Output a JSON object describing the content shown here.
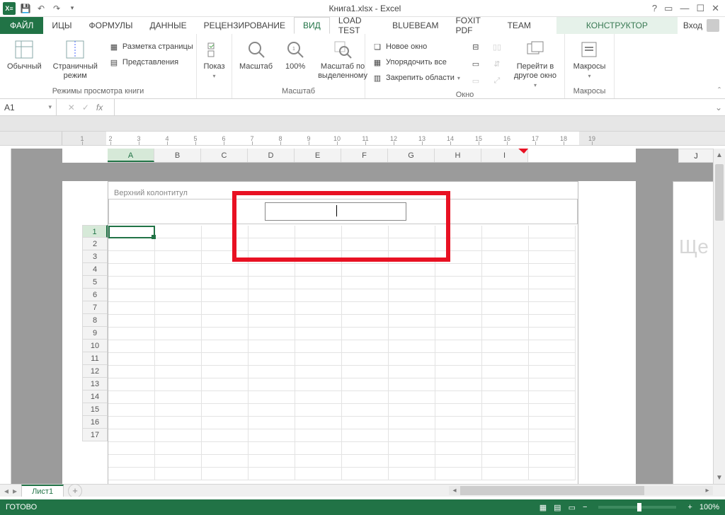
{
  "titlebar": {
    "title": "Книга1.xlsx - Excel"
  },
  "tabs": {
    "file": "ФАЙЛ",
    "items": [
      "ИЦЫ",
      "ФОРМУЛЫ",
      "ДАННЫЕ",
      "РЕЦЕНЗИРОВАНИЕ",
      "ВИД",
      "LOAD TEST",
      "BLUEBEAM",
      "Foxit PDF",
      "TEAM"
    ],
    "active": "ВИД",
    "contextual": "КОНСТРУКТОР",
    "signin": "Вход"
  },
  "ribbon": {
    "group1": {
      "normal": "Обычный",
      "page": "Страничный режим",
      "layout": "Разметка страницы",
      "views": "Представления",
      "label": "Режимы просмотра книги"
    },
    "group2": {
      "show": "Показ",
      "label": ""
    },
    "group3": {
      "zoom": "Масштаб",
      "hundred": "100%",
      "zoomsel": "Масштаб по выделенному",
      "label": "Масштаб"
    },
    "group4": {
      "newwin": "Новое окно",
      "arrange": "Упорядочить все",
      "freeze": "Закрепить области",
      "switch": "Перейти в другое окно",
      "label": "Окно"
    },
    "group5": {
      "macros": "Макросы",
      "label": "Макросы"
    }
  },
  "namebox": "A1",
  "columns": [
    "A",
    "B",
    "C",
    "D",
    "E",
    "F",
    "G",
    "H",
    "I"
  ],
  "column_j": "J",
  "rows": [
    "1",
    "2",
    "3",
    "4",
    "5",
    "6",
    "7",
    "8",
    "9",
    "10",
    "11",
    "12",
    "13",
    "14",
    "15",
    "16",
    "17"
  ],
  "header_label": "Верхний колонтитул",
  "page2_ghost": "Ще",
  "sheet_tab": "Лист1",
  "status": {
    "ready": "ГОТОВО",
    "zoom": "100%"
  },
  "ruler_numbers": [
    "1",
    "2",
    "3",
    "4",
    "5",
    "6",
    "7",
    "8",
    "9",
    "10",
    "11",
    "12",
    "13",
    "14",
    "15",
    "16",
    "17",
    "18",
    "19"
  ]
}
